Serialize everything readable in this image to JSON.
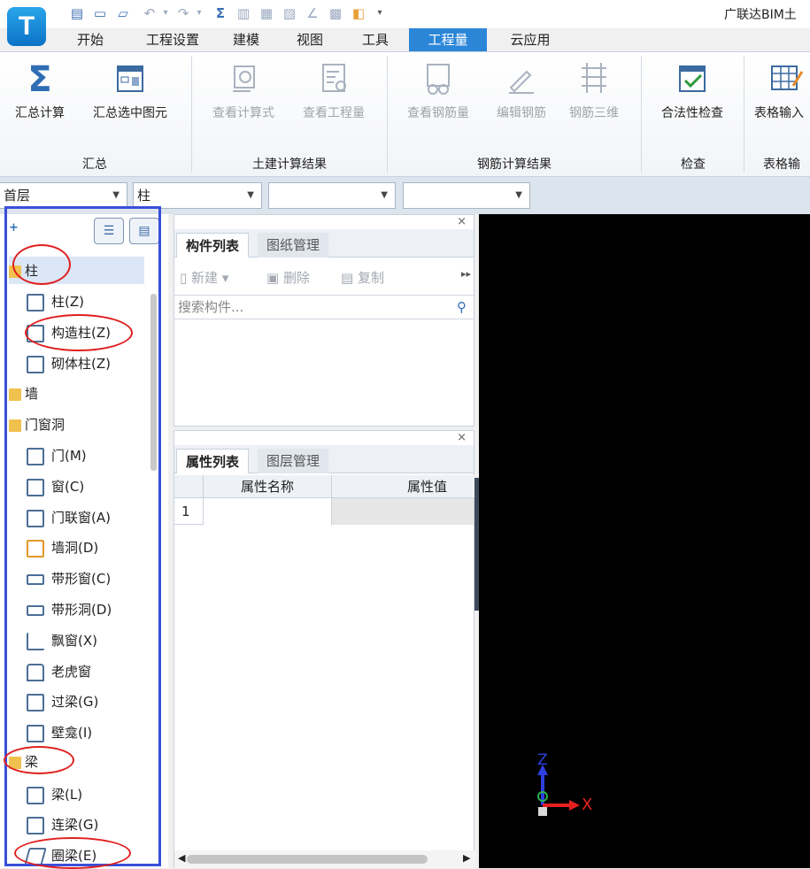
{
  "app": {
    "logo_letter": "T",
    "title": "广联达BIM土"
  },
  "quick_access": [
    "save-icon",
    "new-icon",
    "open-icon",
    "undo-icon",
    "redo-icon",
    "sum-icon",
    "calc-icon",
    "preview-icon",
    "report-icon",
    "draw-icon",
    "grid-icon",
    "export-icon",
    "dropdown-icon"
  ],
  "tabs": [
    {
      "label": "开始"
    },
    {
      "label": "工程设置"
    },
    {
      "label": "建模"
    },
    {
      "label": "视图"
    },
    {
      "label": "工具"
    },
    {
      "label": "工程量",
      "active": true
    },
    {
      "label": "云应用"
    }
  ],
  "ribbon": {
    "groups": [
      {
        "label": "汇总",
        "buttons": [
          {
            "label": "汇总计算",
            "icon": "sigma-icon"
          },
          {
            "label": "汇总选中图元",
            "icon": "calc-selected-icon"
          }
        ]
      },
      {
        "label": "土建计算结果",
        "buttons": [
          {
            "label": "查看计算式",
            "icon": "formula-icon",
            "disabled": true
          },
          {
            "label": "查看工程量",
            "icon": "quantity-icon",
            "disabled": true
          }
        ]
      },
      {
        "label": "钢筋计算结果",
        "buttons": [
          {
            "label": "查看钢筋量",
            "icon": "rebar-view-icon",
            "disabled": true
          },
          {
            "label": "编辑钢筋",
            "icon": "rebar-edit-icon",
            "disabled": true
          },
          {
            "label": "钢筋三维",
            "icon": "rebar-3d-icon",
            "disabled": true
          }
        ]
      },
      {
        "label": "检查",
        "buttons": [
          {
            "label": "合法性检查",
            "icon": "check-icon"
          }
        ]
      },
      {
        "label": "表格输",
        "buttons": [
          {
            "label": "表格输入",
            "icon": "table-input-icon"
          }
        ]
      }
    ]
  },
  "selectors": {
    "floor": "首层",
    "type": "柱",
    "sub1": "",
    "sub2": ""
  },
  "tree": {
    "items": [
      {
        "label": "柱",
        "kind": "category",
        "selected": true
      },
      {
        "label": "柱(Z)",
        "kind": "item"
      },
      {
        "label": "构造柱(Z)",
        "kind": "item"
      },
      {
        "label": "砌体柱(Z)",
        "kind": "item"
      },
      {
        "label": "墙",
        "kind": "category"
      },
      {
        "label": "门窗洞",
        "kind": "category"
      },
      {
        "label": "门(M)",
        "kind": "item"
      },
      {
        "label": "窗(C)",
        "kind": "item"
      },
      {
        "label": "门联窗(A)",
        "kind": "item"
      },
      {
        "label": "墙洞(D)",
        "kind": "item"
      },
      {
        "label": "带形窗(C)",
        "kind": "item"
      },
      {
        "label": "带形洞(D)",
        "kind": "item"
      },
      {
        "label": "飘窗(X)",
        "kind": "item"
      },
      {
        "label": "老虎窗",
        "kind": "item"
      },
      {
        "label": "过梁(G)",
        "kind": "item"
      },
      {
        "label": "壁龛(I)",
        "kind": "item"
      },
      {
        "label": "梁",
        "kind": "category"
      },
      {
        "label": "梁(L)",
        "kind": "item"
      },
      {
        "label": "连梁(G)",
        "kind": "item"
      },
      {
        "label": "圈梁(E)",
        "kind": "item"
      }
    ]
  },
  "component_panel": {
    "tabs": [
      "构件列表",
      "图纸管理"
    ],
    "toolbar": {
      "new": "新建",
      "delete": "删除",
      "copy": "复制"
    },
    "search_placeholder": "搜索构件..."
  },
  "property_panel": {
    "tabs": [
      "属性列表",
      "图层管理"
    ],
    "columns": [
      "属性名称",
      "属性值"
    ],
    "rows": [
      {
        "index": "1",
        "name": "",
        "value": ""
      }
    ]
  },
  "viewport": {
    "axis_z": "Z",
    "axis_x": "X"
  }
}
